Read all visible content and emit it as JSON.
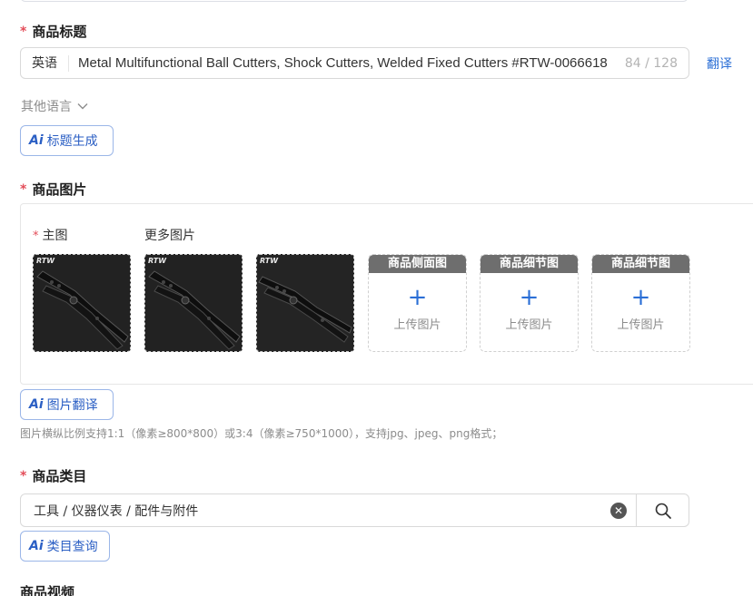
{
  "title_section": {
    "label": "商品标题",
    "lang": "英语",
    "value": "Metal Multifunctional Ball Cutters, Shock Cutters, Welded Fixed Cutters #RTW-0066618",
    "counter": "84 / 128",
    "translate": "翻译",
    "other_lang": "其他语言",
    "ai_button": "标题生成"
  },
  "image_section": {
    "label": "商品图片",
    "main_label": "主图",
    "more_label": "更多图片",
    "thumb_brand": "RTW",
    "slots": [
      {
        "head": "商品侧面图",
        "text": "上传图片"
      },
      {
        "head": "商品细节图",
        "text": "上传图片"
      },
      {
        "head": "商品细节图",
        "text": "上传图片"
      }
    ],
    "ai_button": "图片翻译",
    "hint": "图片横纵比例支持1:1（像素≥800*800）或3:4（像素≥750*1000），支持jpg、jpeg、png格式；"
  },
  "category_section": {
    "label": "商品类目",
    "value": "工具 / 仪器仪表 / 配件与附件",
    "ai_button": "类目查询"
  },
  "video_section": {
    "label": "商品视频"
  },
  "ai_badge": "Ai",
  "required_mark": "*",
  "plus": "+",
  "clear_glyph": "✕",
  "colors": {
    "accent": "#2b6fd6",
    "required": "#e34d59"
  }
}
